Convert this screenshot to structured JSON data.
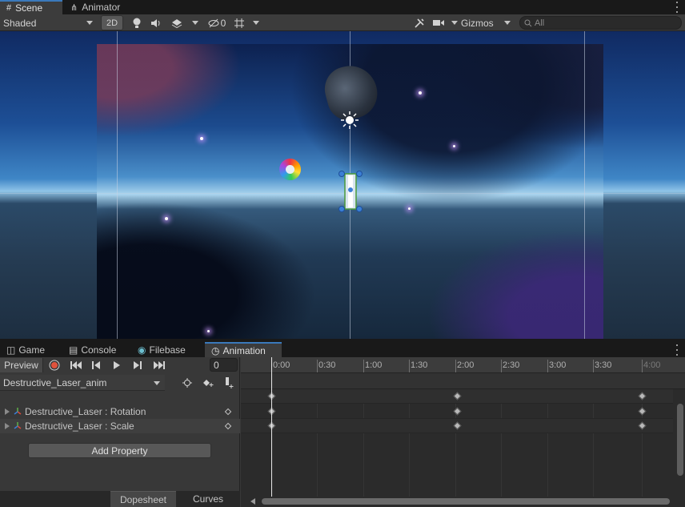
{
  "top_tabs": {
    "scene": "Scene",
    "animator": "Animator"
  },
  "scene_toolbar": {
    "draw_mode": "Shaded",
    "two_d": "2D",
    "hidden_count": "0",
    "gizmos": "Gizmos",
    "search_placeholder": "All"
  },
  "bottom_tabs": {
    "game": "Game",
    "console": "Console",
    "filebase": "Filebase",
    "animation": "Animation"
  },
  "animation": {
    "preview": "Preview",
    "frame": "0",
    "clip_name": "Destructive_Laser_anim",
    "properties": [
      {
        "label": "Destructive_Laser : Rotation"
      },
      {
        "label": "Destructive_Laser : Scale"
      }
    ],
    "add_property": "Add Property",
    "dopesheet": "Dopesheet",
    "curves": "Curves",
    "ruler": [
      "0:00",
      "0:30",
      "1:00",
      "1:30",
      "2:00",
      "2:30",
      "3:00",
      "3:30",
      "4:00"
    ]
  },
  "colors": {
    "accent": "#3a79bb",
    "record": "#e0533d",
    "panel": "#383838"
  }
}
